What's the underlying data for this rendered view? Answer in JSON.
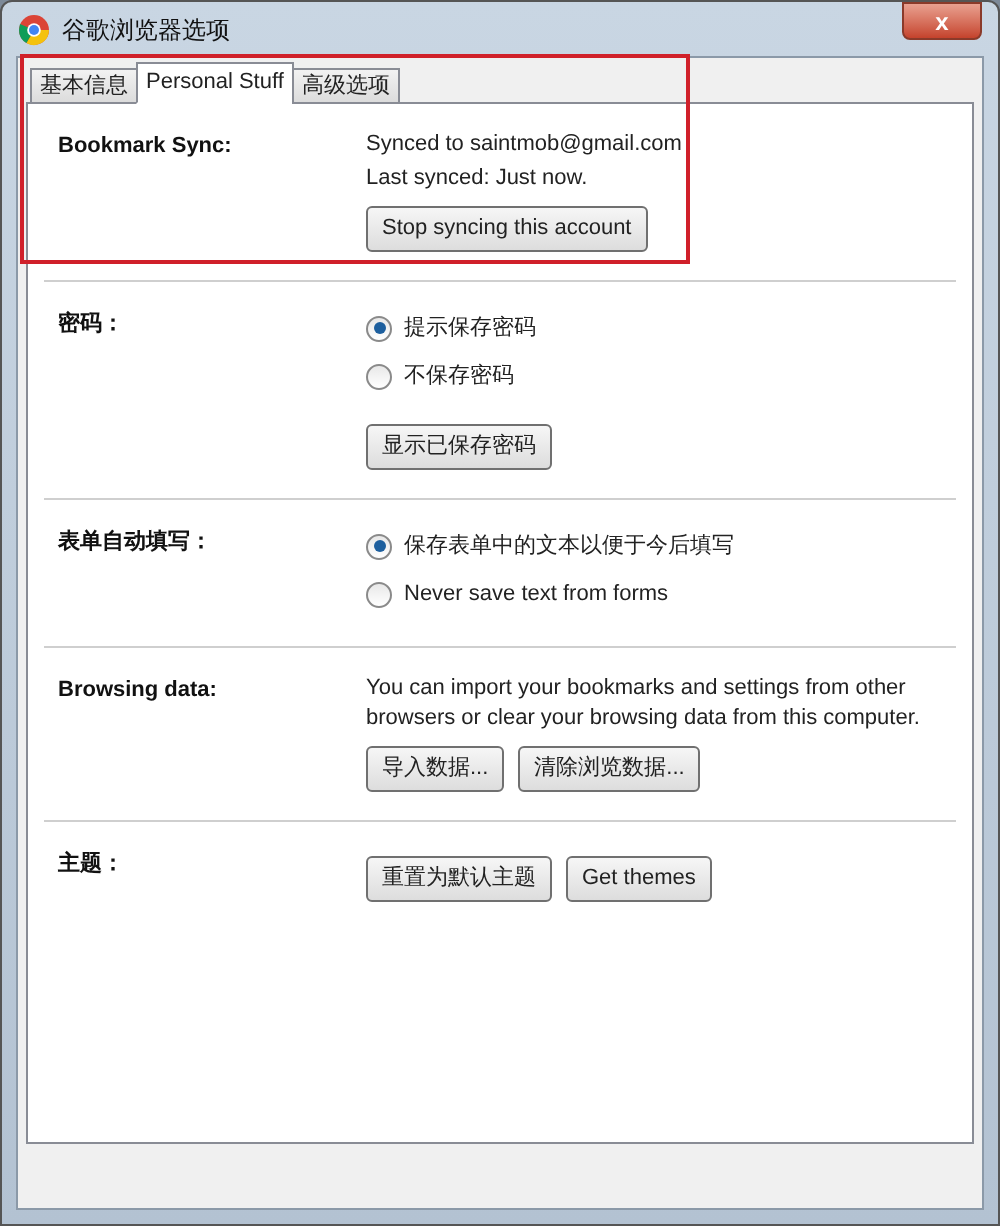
{
  "window": {
    "title": "谷歌浏览器选项",
    "close": "x"
  },
  "tabs": [
    {
      "label": "基本信息",
      "selected": false
    },
    {
      "label": "Personal Stuff",
      "selected": true
    },
    {
      "label": "高级选项",
      "selected": false
    }
  ],
  "highlight": {
    "on": true
  },
  "sections": [
    {
      "label": "Bookmark Sync:",
      "lines": [
        "Synced to saintmob@gmail.com",
        "Last synced: Just now."
      ],
      "buttons": [
        "Stop syncing this account"
      ]
    },
    {
      "label": "密码：",
      "radios": [
        {
          "label": "提示保存密码",
          "selected": true
        },
        {
          "label": "不保存密码",
          "selected": false
        }
      ],
      "buttons": [
        "显示已保存密码"
      ]
    },
    {
      "label": "表单自动填写：",
      "radios": [
        {
          "label": "保存表单中的文本以便于今后填写",
          "selected": true
        },
        {
          "label": "Never save text from forms",
          "selected": false
        }
      ]
    },
    {
      "label": "Browsing data:",
      "lines": [
        "You can import your bookmarks and settings from other browsers or clear your browsing data from this computer."
      ],
      "buttons": [
        "导入数据...",
        "清除浏览数据..."
      ]
    },
    {
      "label": "主题：",
      "buttons": [
        "重置为默认主题",
        "Get themes"
      ]
    }
  ]
}
